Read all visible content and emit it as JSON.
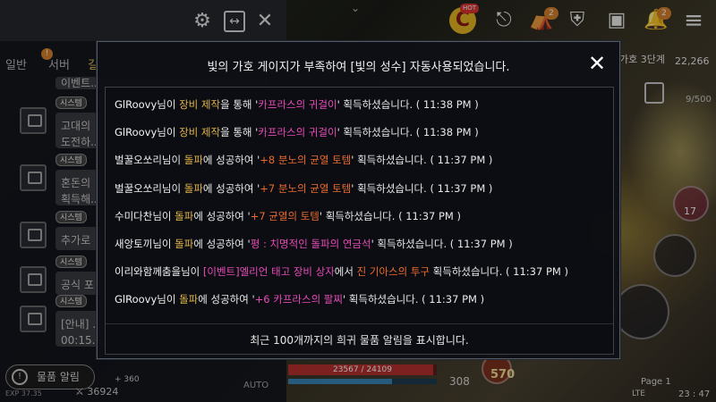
{
  "modal": {
    "title": "빛의 가호 게이지가 부족하여 [빛의 성수] 자동사용되었습니다.",
    "footer": "최근 100개까지의 희귀 물품 알림을 표시합니다.",
    "close_icon": "close-icon",
    "entries": [
      {
        "name": "GlRoovy",
        "p1": "님이 ",
        "act": "장비 제작",
        "p2": "을 통해 '",
        "item": "카프라스의 귀걸이",
        "item_color": "pink",
        "p3": "' 획득하셨습니다. ",
        "time": "( 11:38 PM )"
      },
      {
        "name": "GlRoovy",
        "p1": "님이 ",
        "act": "장비 제작",
        "p2": "을 통해 '",
        "item": "카프라스의 귀걸이",
        "item_color": "pink",
        "p3": "' 획득하셨습니다. ",
        "time": "( 11:38 PM )"
      },
      {
        "name": "벌꿀오쏘리",
        "p1": "님이 ",
        "act": "돌파",
        "p2": "에 성공하여 '",
        "item": "+8 분노의 균열 토템",
        "item_color": "orange",
        "p3": "' 획득하셨습니다. ",
        "time": "( 11:37 PM )"
      },
      {
        "name": "벌꿀오쏘리",
        "p1": "님이 ",
        "act": "돌파",
        "p2": "에 성공하여 '",
        "item": "+7 분노의 균열 토템",
        "item_color": "orange",
        "p3": "' 획득하셨습니다. ",
        "time": "( 11:37 PM )"
      },
      {
        "name": "수미다찬",
        "p1": "님이 ",
        "act": "돌파",
        "p2": "에 성공하여 '",
        "item": "+7 균열의 토템",
        "item_color": "orange",
        "p3": "' 획득하셨습니다. ",
        "time": "( 11:37 PM )"
      },
      {
        "name": "새앙토끼",
        "p1": "님이 ",
        "act": "돌파",
        "p2": "에 성공하여 '",
        "item": "평 : 치명적인 돌파의 연금석",
        "item_color": "pink",
        "p3": "' 획득하셨습니다. ",
        "time": "( 11:37 PM )"
      },
      {
        "name": "이리와함께춤을",
        "p1": "님이 ",
        "act": "[이벤트]엘리언 태고 장비 상자",
        "act_color": "pink",
        "p2": "에서 ",
        "item": "진 기아스의 투구",
        "item_color": "orange",
        "p3": " 획득하셨습니다. ",
        "time": "( 11:37 PM )"
      },
      {
        "name": "GlRoovy",
        "p1": "님이 ",
        "act": "돌파",
        "p2": "에 성공하여 '",
        "item": "+6 카프라스의 팔찌",
        "item_color": "pink",
        "p3": "' 획득하셨습니다. ",
        "time": "( 11:37 PM )"
      }
    ]
  },
  "chat": {
    "tabs": [
      "일반",
      "서버",
      "길"
    ],
    "tab_badge": "!",
    "rows": [
      {
        "tag": "",
        "text": "이벤트..."
      },
      {
        "tag": "시스템",
        "text": "고대의\n도전하..."
      },
      {
        "tag": "시스템",
        "text": "혼돈의\n획득해..."
      },
      {
        "tag": "시스템",
        "text": "추가로"
      },
      {
        "tag": "시스템",
        "text": "공식 포"
      },
      {
        "tag": "시스템",
        "text": "[안내] ...\n00:15..."
      }
    ],
    "item_alert": "물품 알림"
  },
  "hud": {
    "hot": "HOT",
    "badge_tent": "2",
    "badge_bell": "2",
    "quest_label": "가호 3단계",
    "quest_count": "22,266",
    "bag_count": "9/500",
    "potion_count": "17",
    "hp": {
      "text": "23567 / 24109",
      "fraction": 0.978
    },
    "mp_fraction": 0.7,
    "mana": "308",
    "gold": "570",
    "power": "36924",
    "power_delta": "+ 360",
    "exp": "EXP 37.35",
    "auto": "AUTO",
    "page": "Page 1",
    "lte": "LTE",
    "clock": "23 : 47"
  },
  "colors": {
    "accent_gold": "#e2b44a",
    "item_pink": "#e84bb8",
    "item_orange": "#ec6a2e",
    "hp_red": "#b83030",
    "badge_orange": "#d9822b"
  }
}
